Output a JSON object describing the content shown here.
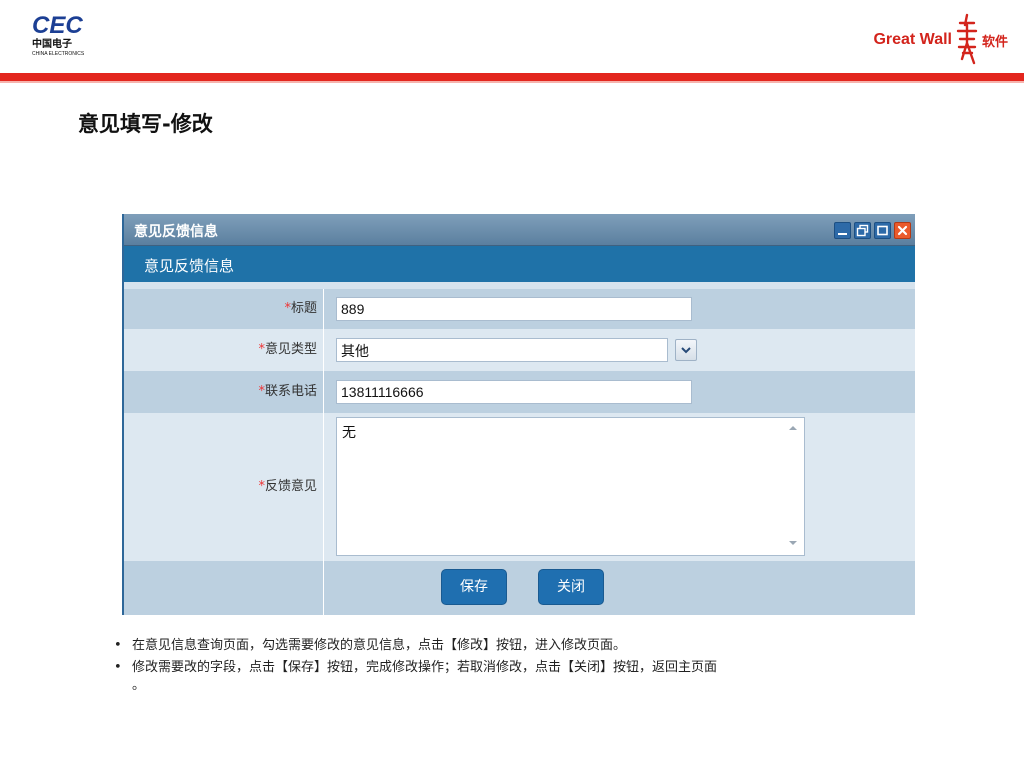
{
  "header": {
    "cec_logo": {
      "word": "CEC",
      "cn": "中国电子",
      "en": "CHINA ELECTRONICS"
    },
    "gw_logo": {
      "word": "Great Wall",
      "cn": "软件"
    },
    "colors": {
      "accent_red": "#e3261e",
      "brand_blue": "#1c3f94"
    }
  },
  "slide_title": "意见填写-修改",
  "window": {
    "title": "意见反馈信息",
    "controls": [
      "minimize-icon",
      "restore-icon",
      "maximize-icon",
      "close-icon"
    ],
    "section_header": "意见反馈信息",
    "fields": [
      {
        "required_mark": "*",
        "label": "标题",
        "value": "889"
      },
      {
        "required_mark": "*",
        "label": "意见类型",
        "value": "其他"
      },
      {
        "required_mark": "*",
        "label": "联系电话",
        "value": "13811116666"
      },
      {
        "required_mark": "*",
        "label": "反馈意见",
        "value": "无"
      }
    ],
    "buttons": {
      "save": "保存",
      "close": "关闭"
    }
  },
  "bullets": [
    "在意见信息查询页面，勾选需要修改的意见信息，点击【修改】按钮，进入修改页面。",
    "修改需要改的字段，点击【保存】按钮，完成修改操作；若取消修改，点击【关闭】按钮，返回主页面",
    "。"
  ]
}
